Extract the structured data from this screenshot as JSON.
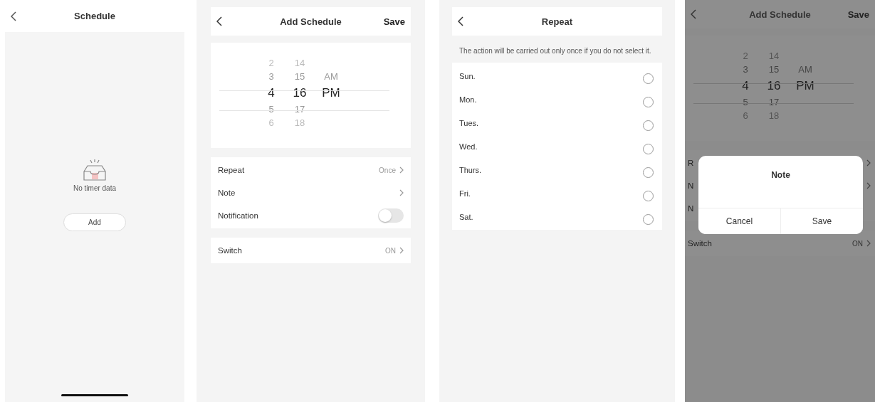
{
  "screens": [
    {
      "kind": "empty",
      "title": "Schedule",
      "empty_text": "No timer data",
      "add_button": "Add"
    },
    {
      "kind": "form",
      "title": "Add Schedule",
      "action": "Save",
      "picker": [
        {
          "items": [
            {
              "label": "2",
              "selected": false
            },
            {
              "label": "3",
              "selected": false
            },
            {
              "label": "4",
              "selected": true
            },
            {
              "label": "5",
              "selected": false
            },
            {
              "label": "6",
              "selected": false
            }
          ]
        },
        {
          "items": [
            {
              "label": "14",
              "selected": false
            },
            {
              "label": "15",
              "selected": false
            },
            {
              "label": "16",
              "selected": true
            },
            {
              "label": "17",
              "selected": false
            },
            {
              "label": "18",
              "selected": false
            }
          ]
        },
        {
          "items": [
            {
              "label": "AM",
              "selected": false
            },
            {
              "label": "PM",
              "selected": true
            }
          ]
        }
      ],
      "groups": [
        [
          {
            "kind": "link",
            "label": "Repeat",
            "value": "Once"
          },
          {
            "kind": "link",
            "label": "Note"
          },
          {
            "kind": "toggle",
            "label": "Notification",
            "on": false
          }
        ],
        [
          {
            "kind": "link",
            "label": "Switch",
            "value": "ON"
          }
        ]
      ]
    },
    {
      "kind": "repeat",
      "title": "Repeat",
      "hint": "The action will be carried out only once if you do not select it.",
      "days": [
        {
          "label": "Sun.",
          "checked": false
        },
        {
          "label": "Mon.",
          "checked": false
        },
        {
          "label": "Tues.",
          "checked": false
        },
        {
          "label": "Wed.",
          "checked": false
        },
        {
          "label": "Thurs.",
          "checked": false
        },
        {
          "label": "Fri.",
          "checked": false
        },
        {
          "label": "Sat.",
          "checked": false
        }
      ]
    },
    {
      "kind": "dialog",
      "title": "Add Schedule",
      "action": "Save",
      "picker": [
        {
          "items": [
            {
              "label": "2",
              "selected": false
            },
            {
              "label": "3",
              "selected": false
            },
            {
              "label": "4",
              "selected": true
            },
            {
              "label": "5",
              "selected": false
            },
            {
              "label": "6",
              "selected": false
            }
          ]
        },
        {
          "items": [
            {
              "label": "14",
              "selected": false
            },
            {
              "label": "15",
              "selected": false
            },
            {
              "label": "16",
              "selected": true
            },
            {
              "label": "17",
              "selected": false
            },
            {
              "label": "18",
              "selected": false
            }
          ]
        },
        {
          "items": [
            {
              "label": "AM",
              "selected": false
            },
            {
              "label": "PM",
              "selected": true
            }
          ]
        }
      ],
      "groups": [
        [
          {
            "kind": "link",
            "label": "R"
          },
          {
            "kind": "link",
            "label": "N"
          },
          {
            "kind": "text",
            "label": "N"
          }
        ],
        [
          {
            "kind": "link",
            "label": "Switch",
            "value": "ON"
          }
        ]
      ],
      "dialog": {
        "title": "Note",
        "cancel": "Cancel",
        "confirm": "Save"
      }
    }
  ]
}
